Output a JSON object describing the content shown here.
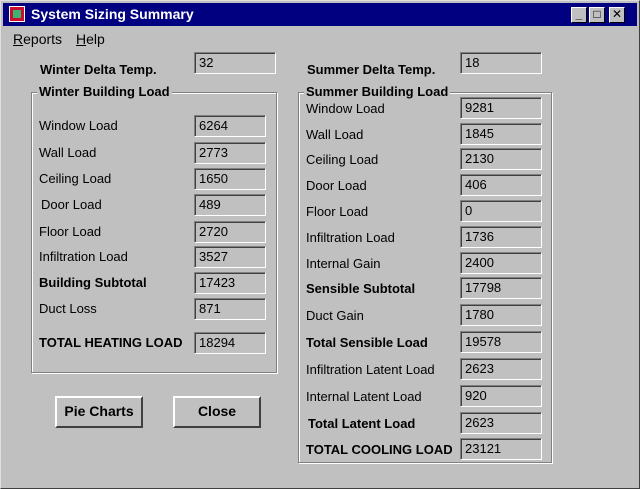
{
  "window": {
    "title": "System Sizing Summary"
  },
  "menu": {
    "reports": "Reports",
    "help": "Help"
  },
  "winter_delta": {
    "label": "Winter Delta Temp.",
    "value": "32"
  },
  "summer_delta": {
    "label": "Summer Delta Temp.",
    "value": "18"
  },
  "winter": {
    "title": "Winter Building Load",
    "rows": [
      {
        "label": "Window Load",
        "value": "6264"
      },
      {
        "label": "Wall Load",
        "value": "2773"
      },
      {
        "label": "Ceiling Load",
        "value": "1650"
      },
      {
        "label": "Door Load",
        "value": "489"
      },
      {
        "label": "Floor Load",
        "value": "2720"
      },
      {
        "label": "Infiltration Load",
        "value": "3527"
      },
      {
        "label": "Building Subtotal",
        "value": "17423"
      },
      {
        "label": "Duct Loss",
        "value": "871"
      },
      {
        "label": "TOTAL HEATING LOAD",
        "value": "18294"
      }
    ]
  },
  "summer": {
    "title": "Summer Building Load",
    "rows": [
      {
        "label": "Window Load",
        "value": "9281"
      },
      {
        "label": "Wall Load",
        "value": "1845"
      },
      {
        "label": "Ceiling Load",
        "value": "2130"
      },
      {
        "label": "Door Load",
        "value": "406"
      },
      {
        "label": "Floor Load",
        "value": "0"
      },
      {
        "label": "Infiltration Load",
        "value": "1736"
      },
      {
        "label": "Internal Gain",
        "value": "2400"
      },
      {
        "label": "Sensible Subtotal",
        "value": "17798"
      },
      {
        "label": "Duct Gain",
        "value": "1780"
      },
      {
        "label": "Total Sensible Load",
        "value": "19578"
      },
      {
        "label": "Infiltration Latent Load",
        "value": "2623"
      },
      {
        "label": "Internal Latent Load",
        "value": "920"
      },
      {
        "label": "Total Latent Load",
        "value": "2623"
      },
      {
        "label": "TOTAL COOLING LOAD",
        "value": "23121"
      }
    ]
  },
  "buttons": {
    "pie_charts": "Pie Charts",
    "close": "Close"
  }
}
